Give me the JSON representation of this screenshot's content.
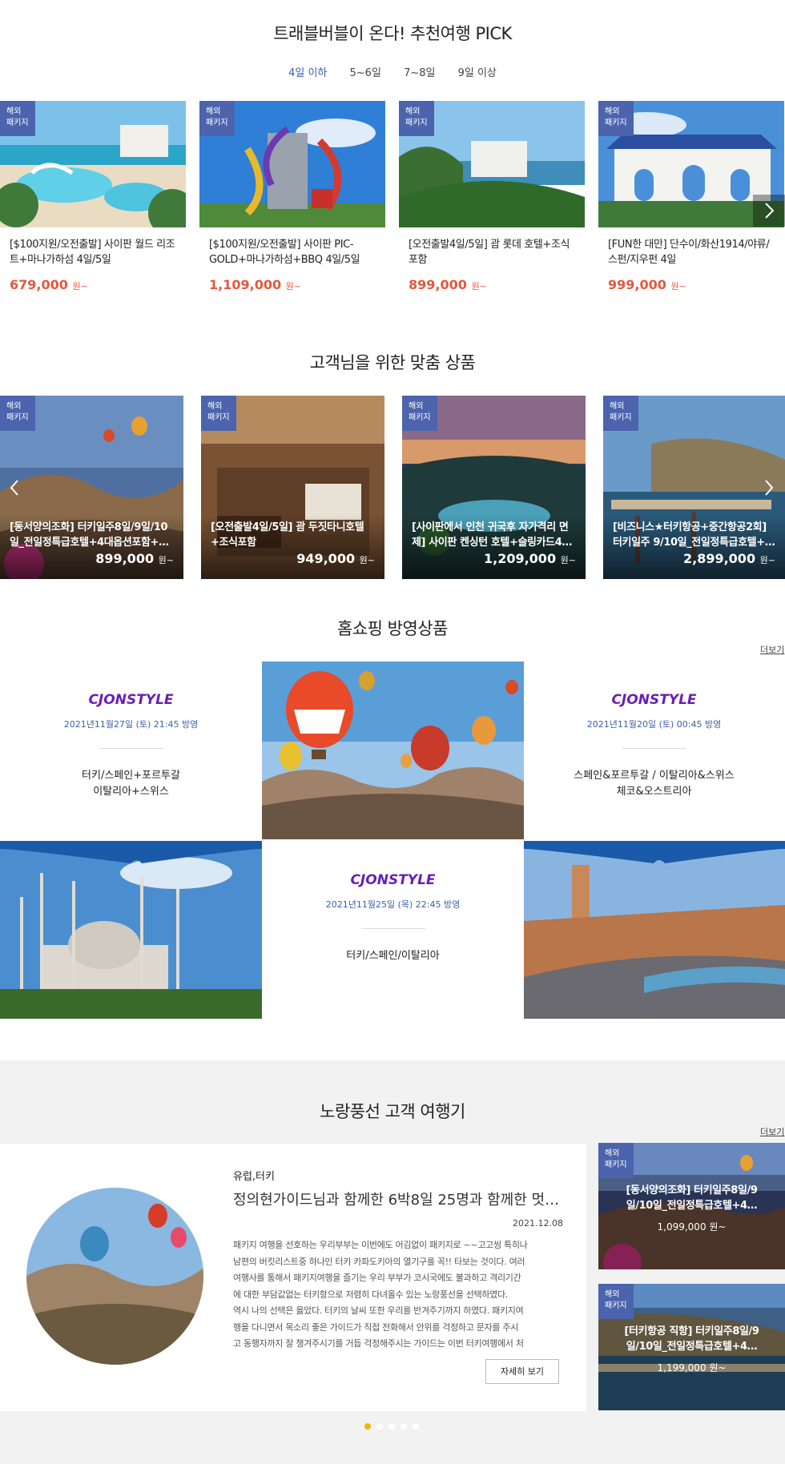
{
  "pick": {
    "title": "트래블버블이 온다! 추천여행 PICK",
    "tabs": [
      "4일 이하",
      "5~6일",
      "7~8일",
      "9일 이상"
    ],
    "badge_line1": "해외",
    "badge_line2": "패키지",
    "currency": "원~",
    "cards": [
      {
        "title": "[$100지원/오전출발] 사이판 월드 리조트+마나가하섬 4일/5일",
        "price": "679,000"
      },
      {
        "title": "[$100지원/오전출발] 사이판 PIC-GOLD+마나가하섬+BBQ 4일/5일",
        "price": "1,109,000"
      },
      {
        "title": "[오전출발4일/5일] 괌 롯데 호텔+조식포함",
        "price": "899,000"
      },
      {
        "title": "[FUN한 대만] 단수이/화산1914/야류/스펀/지우펀 4일",
        "price": "999,000"
      }
    ]
  },
  "custom": {
    "title": "고객님을 위한 맞춤 상품",
    "cards": [
      {
        "line1": "[동서양의조화] 터키일주8일/9일/10",
        "line2": "일_전일정특급호텔+4대옵션포함+…",
        "price": "899,000"
      },
      {
        "line1": "[오전출발4일/5일] 괌 두짓타니호텔",
        "line2": "+조식포함",
        "price": "949,000"
      },
      {
        "line1": "[사이판에서 인천 귀국후 자가격리 면",
        "line2": "제] 사이판 켄싱턴 호텔+슬링카드4…",
        "price": "1,209,000"
      },
      {
        "line1": "[비즈니스★터키항공+중간항공2회]",
        "line2": "터키일주 9/10일_전일정특급호텔+4…",
        "price": "2,899,000"
      }
    ]
  },
  "homeshop": {
    "title": "홈쇼핑 방영상품",
    "more": "더보기",
    "brand_a": "CJ",
    "brand_b": "ONSTYLE",
    "items": [
      {
        "date": "2021년11월27일 (토) 21:45 방영",
        "desc1": "터키/스페인+포르투갈",
        "desc2": "이탈리아+스위스"
      },
      {
        "date": "2021년11월20일 (토) 00:45 방영",
        "desc1": "스페인&포르투갈 / 이탈리아&스위스",
        "desc2": "체코&오스트리아"
      },
      {
        "date": "2021년11월25일 (목) 22:45 방영",
        "desc1": "터키/스페인/이탈리아",
        "desc2": ""
      }
    ]
  },
  "review": {
    "title": "노랑풍선 고객 여행기",
    "more": "더보기",
    "region": "유럽,터키",
    "headline": "정의현가이드님과 함께한 6박8일 25명과 함께한 멋진…",
    "date": "2021.12.08",
    "body": [
      "패키지 여행을 선호하는 우리부부는 이번에도 어김없이 패키지로 ~~고고씽 특히나",
      "남편의 버킷리스트중 하나인 터키 카파도키아의 열기구를 꼭!! 타보는 것이다. 여러",
      "여행사를 통해서 패키지여행을 즐기는 우리 부부가 코시국에도 불과하고 격리기간",
      "에 대한 부담값없는 터키항으로 저렴히 다녀올수 있는 노랑풍선을 선택하였다.",
      "역시 나의 선택은 옳았다. 터키의 날씨 또한 우리를 반겨주기까지 하였다. 패키지여",
      "행을 다니면서 목소리 좋은 가이드가 직접 전화해서 안위를 걱정하고 문자를 주시",
      "고 동행자까지 잘 챙겨주시기를 거듭 걱정해주시는 가이드는 이번 터키여행에서 처"
    ],
    "detail_button": "자세히 보기",
    "side_cards": [
      {
        "line1": "[동서양의조화] 터키일주8일/9",
        "line2": "일/10일_전일정특급호텔+4…",
        "price": "1,099,000 원~"
      },
      {
        "line1": "[터키항공 직항] 터키일주8일/9",
        "line2": "일/10일_전일정특급호텔+4…",
        "price": "1,199,000 원~"
      }
    ]
  },
  "colors": {
    "accent": "#3a5fa8",
    "price": "#e8573d",
    "badge": "#4b64ad",
    "brand": "#6a1fb6",
    "dot_active": "#f2b600"
  }
}
